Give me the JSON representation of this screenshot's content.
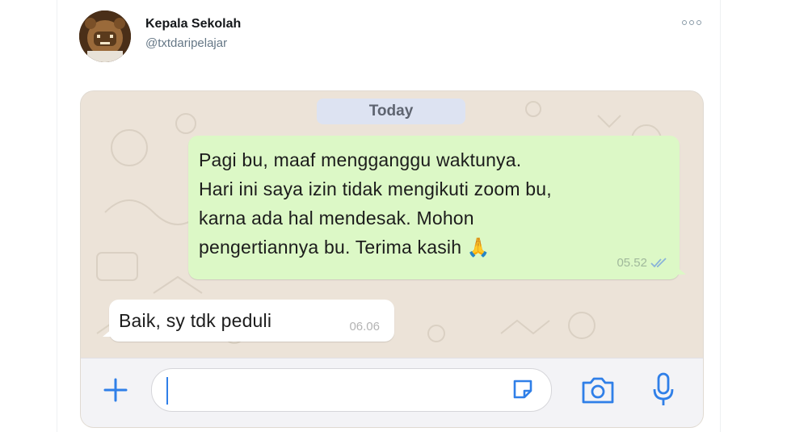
{
  "tweet": {
    "author_name": "Kepala Sekolah",
    "author_handle": "@txtdaripelajar",
    "avatar_icon": "bear-avatar-icon",
    "more_icon": "more-options-icon"
  },
  "chat": {
    "date_label": "Today",
    "messages": [
      {
        "direction": "outgoing",
        "text": "Pagi bu, maaf mengganggu waktunya.\nHari ini saya izin tidak mengikuti zoom bu,\nkarna ada hal mendesak. Mohon\npengertiannya bu. Terima kasih",
        "emoji": "🙏",
        "time": "05.52",
        "status_icon": "double-check-icon"
      },
      {
        "direction": "incoming",
        "text": "Baik, sy tdk peduli",
        "time": "06.06"
      }
    ],
    "input": {
      "placeholder": "",
      "value": ""
    },
    "icons": [
      "plus-icon",
      "sticker-icon",
      "camera-icon",
      "microphone-icon"
    ]
  },
  "colors": {
    "outgoing_bubble": "#dcf8c6",
    "incoming_bubble": "#ffffff",
    "chat_background": "#ece3d8",
    "accent_blue": "#2f7fe8",
    "date_pill": "#dde3f2"
  }
}
